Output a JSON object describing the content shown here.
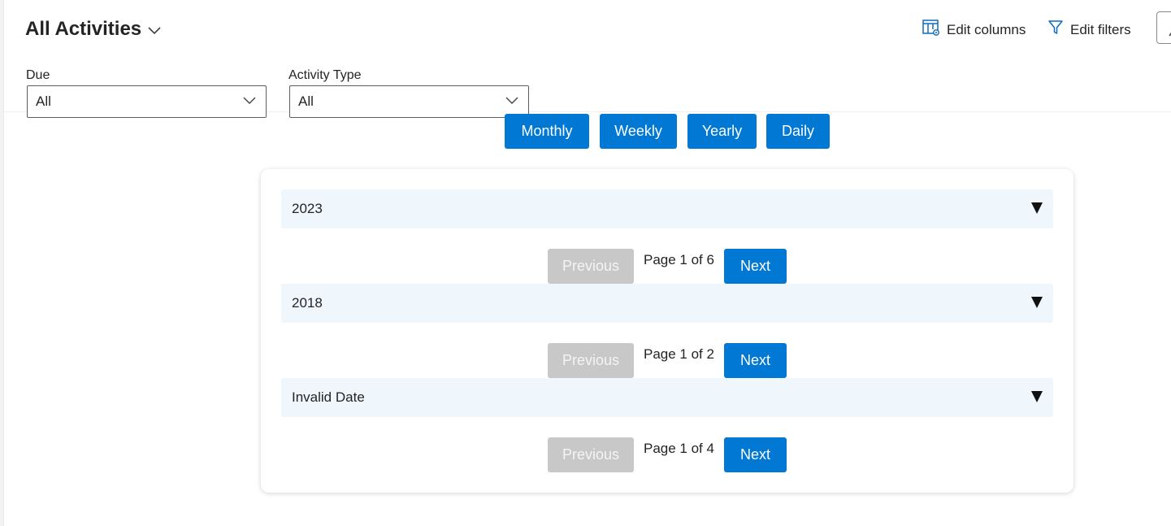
{
  "header": {
    "view_title": "All Activities",
    "commands": {
      "edit_columns": "Edit columns",
      "edit_filters": "Edit filters"
    }
  },
  "filters": {
    "due": {
      "label": "Due",
      "value": "All"
    },
    "activity_type": {
      "label": "Activity Type",
      "value": "All"
    }
  },
  "period_buttons": [
    "Monthly",
    "Weekly",
    "Yearly",
    "Daily"
  ],
  "groups": [
    {
      "label": "2023",
      "pager": {
        "previous": "Previous",
        "page_text": "Page 1 of 6",
        "next": "Next"
      }
    },
    {
      "label": "2018",
      "pager": {
        "previous": "Previous",
        "page_text": "Page 1 of 2",
        "next": "Next"
      }
    },
    {
      "label": "Invalid Date",
      "pager": {
        "previous": "Previous",
        "page_text": "Page 1 of 4",
        "next": "Next"
      }
    }
  ],
  "colors": {
    "accent": "#0078d4",
    "disabled_button": "#c8c8c8",
    "group_row_bg": "#eff6fc"
  },
  "icons": {
    "title_dropdown": "chevron-down-icon",
    "edit_columns": "edit-columns-icon",
    "edit_filters": "funnel-icon",
    "group_expand": "caret-down-icon"
  }
}
